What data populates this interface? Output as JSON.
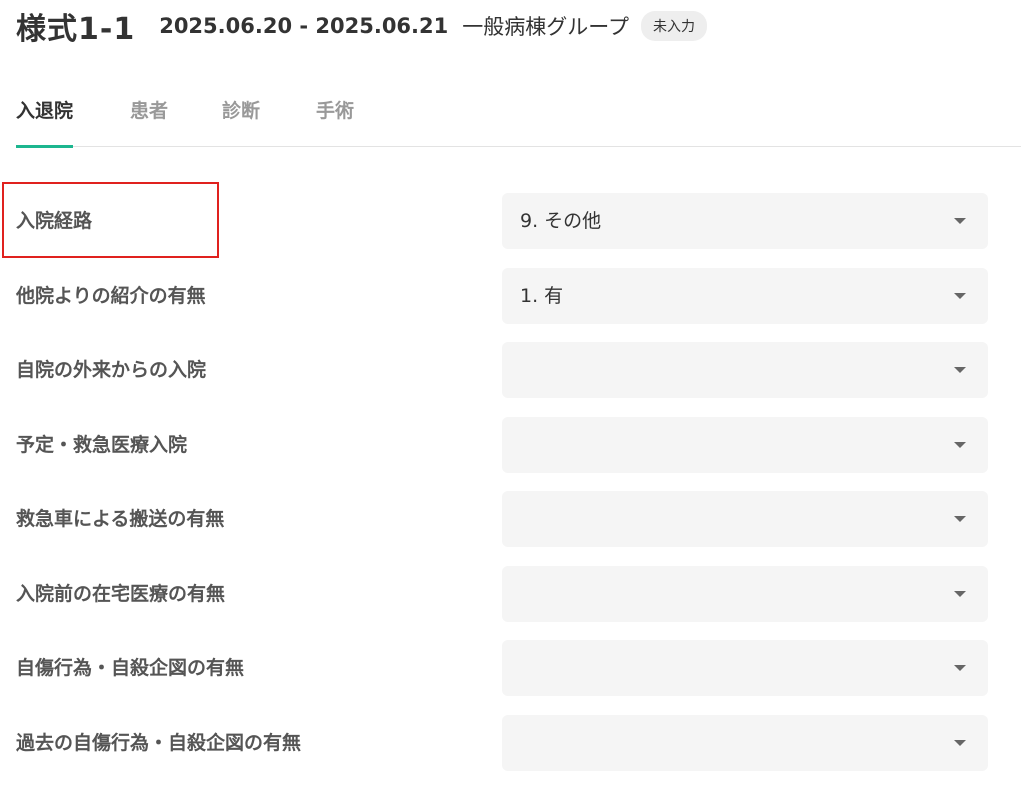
{
  "header": {
    "form_name": "様式1-1",
    "date_range": "2025.06.20 - 2025.06.21",
    "group_name": "一般病棟グループ",
    "status_badge": "未入力"
  },
  "tabs": [
    {
      "label": "入退院",
      "active": true
    },
    {
      "label": "患者",
      "active": false
    },
    {
      "label": "診断",
      "active": false
    },
    {
      "label": "手術",
      "active": false
    }
  ],
  "fields": [
    {
      "label": "入院経路",
      "value": "9. その他"
    },
    {
      "label": "他院よりの紹介の有無",
      "value": "1. 有"
    },
    {
      "label": "自院の外来からの入院",
      "value": ""
    },
    {
      "label": "予定・救急医療入院",
      "value": ""
    },
    {
      "label": "救急車による搬送の有無",
      "value": ""
    },
    {
      "label": "入院前の在宅医療の有無",
      "value": ""
    },
    {
      "label": "自傷行為・自殺企図の有無",
      "value": ""
    },
    {
      "label": "過去の自傷行為・自殺企図の有無",
      "value": ""
    }
  ],
  "colors": {
    "accent": "#1cb68f",
    "highlight": "#e0211e",
    "select_bg": "#f5f5f5"
  },
  "icons": {
    "dropdown": "caret-down-icon"
  }
}
